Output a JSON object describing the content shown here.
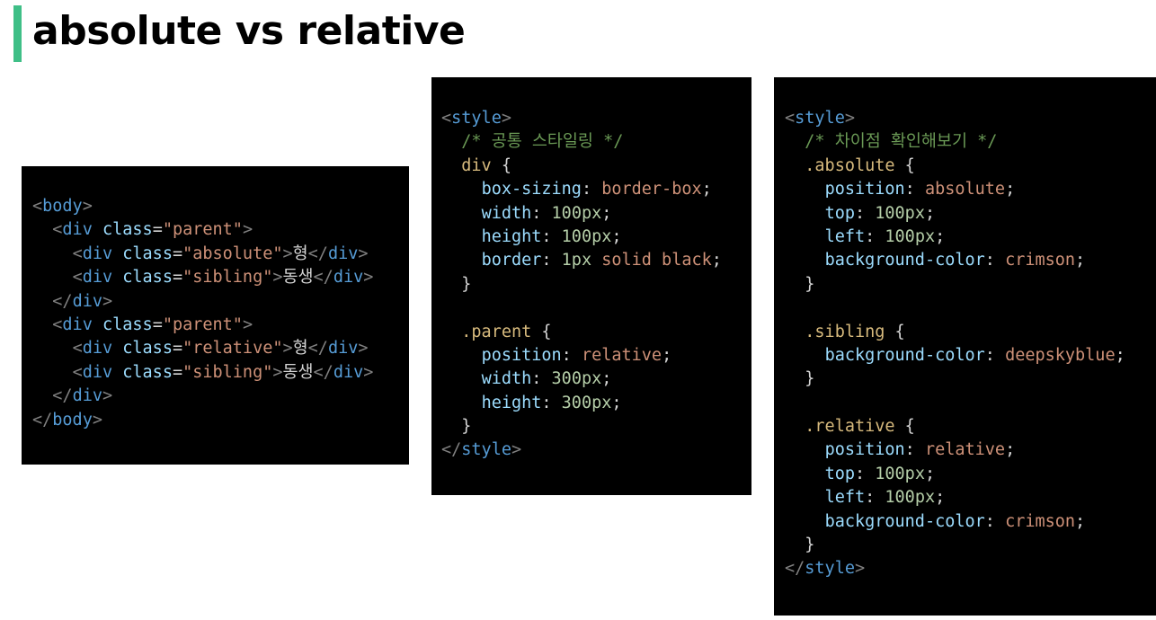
{
  "title": "absolute vs relative",
  "colors": {
    "accent_bar": "#3fbf87",
    "code_background": "#000000",
    "tag": "#569cd6",
    "attribute": "#9cdcfe",
    "string": "#ce9178",
    "comment": "#6a9955",
    "selector": "#d7ba7d",
    "number": "#b5cea8"
  },
  "code_blocks": [
    {
      "name": "html-code",
      "lines": [
        [
          [
            "t-punct",
            "<"
          ],
          [
            "t-tag",
            "body"
          ],
          [
            "t-punct",
            ">"
          ]
        ],
        [
          [
            "t-text",
            "  "
          ],
          [
            "t-punct",
            "<"
          ],
          [
            "t-tag",
            "div"
          ],
          [
            "t-text",
            " "
          ],
          [
            "t-attr",
            "class"
          ],
          [
            "t-eq",
            "="
          ],
          [
            "t-str",
            "\"parent\""
          ],
          [
            "t-punct",
            ">"
          ]
        ],
        [
          [
            "t-text",
            "    "
          ],
          [
            "t-punct",
            "<"
          ],
          [
            "t-tag",
            "div"
          ],
          [
            "t-text",
            " "
          ],
          [
            "t-attr",
            "class"
          ],
          [
            "t-eq",
            "="
          ],
          [
            "t-str",
            "\"absolute\""
          ],
          [
            "t-punct",
            ">"
          ],
          [
            "t-text",
            "형"
          ],
          [
            "t-punct",
            "</"
          ],
          [
            "t-tag",
            "div"
          ],
          [
            "t-punct",
            ">"
          ]
        ],
        [
          [
            "t-text",
            "    "
          ],
          [
            "t-punct",
            "<"
          ],
          [
            "t-tag",
            "div"
          ],
          [
            "t-text",
            " "
          ],
          [
            "t-attr",
            "class"
          ],
          [
            "t-eq",
            "="
          ],
          [
            "t-str",
            "\"sibling\""
          ],
          [
            "t-punct",
            ">"
          ],
          [
            "t-text",
            "동생"
          ],
          [
            "t-punct",
            "</"
          ],
          [
            "t-tag",
            "div"
          ],
          [
            "t-punct",
            ">"
          ]
        ],
        [
          [
            "t-text",
            "  "
          ],
          [
            "t-punct",
            "</"
          ],
          [
            "t-tag",
            "div"
          ],
          [
            "t-punct",
            ">"
          ]
        ],
        [
          [
            "t-text",
            "  "
          ],
          [
            "t-punct",
            "<"
          ],
          [
            "t-tag",
            "div"
          ],
          [
            "t-text",
            " "
          ],
          [
            "t-attr",
            "class"
          ],
          [
            "t-eq",
            "="
          ],
          [
            "t-str",
            "\"parent\""
          ],
          [
            "t-punct",
            ">"
          ]
        ],
        [
          [
            "t-text",
            "    "
          ],
          [
            "t-punct",
            "<"
          ],
          [
            "t-tag",
            "div"
          ],
          [
            "t-text",
            " "
          ],
          [
            "t-attr",
            "class"
          ],
          [
            "t-eq",
            "="
          ],
          [
            "t-str",
            "\"relative\""
          ],
          [
            "t-punct",
            ">"
          ],
          [
            "t-text",
            "형"
          ],
          [
            "t-punct",
            "</"
          ],
          [
            "t-tag",
            "div"
          ],
          [
            "t-punct",
            ">"
          ]
        ],
        [
          [
            "t-text",
            "    "
          ],
          [
            "t-punct",
            "<"
          ],
          [
            "t-tag",
            "div"
          ],
          [
            "t-text",
            " "
          ],
          [
            "t-attr",
            "class"
          ],
          [
            "t-eq",
            "="
          ],
          [
            "t-str",
            "\"sibling\""
          ],
          [
            "t-punct",
            ">"
          ],
          [
            "t-text",
            "동생"
          ],
          [
            "t-punct",
            "</"
          ],
          [
            "t-tag",
            "div"
          ],
          [
            "t-punct",
            ">"
          ]
        ],
        [
          [
            "t-text",
            "  "
          ],
          [
            "t-punct",
            "</"
          ],
          [
            "t-tag",
            "div"
          ],
          [
            "t-punct",
            ">"
          ]
        ],
        [
          [
            "t-punct",
            "</"
          ],
          [
            "t-tag",
            "body"
          ],
          [
            "t-punct",
            ">"
          ]
        ]
      ]
    },
    {
      "name": "style-common-code",
      "lines": [
        [
          [
            "t-punct",
            "<"
          ],
          [
            "t-tag",
            "style"
          ],
          [
            "t-punct",
            ">"
          ]
        ],
        [
          [
            "t-text",
            "  "
          ],
          [
            "t-comment",
            "/* 공통 스타일링 */"
          ]
        ],
        [
          [
            "t-text",
            "  "
          ],
          [
            "t-sel",
            "div"
          ],
          [
            "t-brace",
            " {"
          ]
        ],
        [
          [
            "t-text",
            "    "
          ],
          [
            "t-prop",
            "box-sizing"
          ],
          [
            "t-brace",
            ": "
          ],
          [
            "t-val",
            "border-box"
          ],
          [
            "t-brace",
            ";"
          ]
        ],
        [
          [
            "t-text",
            "    "
          ],
          [
            "t-prop",
            "width"
          ],
          [
            "t-brace",
            ": "
          ],
          [
            "t-num",
            "100px"
          ],
          [
            "t-brace",
            ";"
          ]
        ],
        [
          [
            "t-text",
            "    "
          ],
          [
            "t-prop",
            "height"
          ],
          [
            "t-brace",
            ": "
          ],
          [
            "t-num",
            "100px"
          ],
          [
            "t-brace",
            ";"
          ]
        ],
        [
          [
            "t-text",
            "    "
          ],
          [
            "t-prop",
            "border"
          ],
          [
            "t-brace",
            ": "
          ],
          [
            "t-num",
            "1px"
          ],
          [
            "t-brace",
            " "
          ],
          [
            "t-val",
            "solid black"
          ],
          [
            "t-brace",
            ";"
          ]
        ],
        [
          [
            "t-text",
            "  "
          ],
          [
            "t-brace",
            "}"
          ]
        ],
        [
          [
            "t-text",
            ""
          ]
        ],
        [
          [
            "t-text",
            "  "
          ],
          [
            "t-sel",
            ".parent"
          ],
          [
            "t-brace",
            " {"
          ]
        ],
        [
          [
            "t-text",
            "    "
          ],
          [
            "t-prop",
            "position"
          ],
          [
            "t-brace",
            ": "
          ],
          [
            "t-val",
            "relative"
          ],
          [
            "t-brace",
            ";"
          ]
        ],
        [
          [
            "t-text",
            "    "
          ],
          [
            "t-prop",
            "width"
          ],
          [
            "t-brace",
            ": "
          ],
          [
            "t-num",
            "300px"
          ],
          [
            "t-brace",
            ";"
          ]
        ],
        [
          [
            "t-text",
            "    "
          ],
          [
            "t-prop",
            "height"
          ],
          [
            "t-brace",
            ": "
          ],
          [
            "t-num",
            "300px"
          ],
          [
            "t-brace",
            ";"
          ]
        ],
        [
          [
            "t-text",
            "  "
          ],
          [
            "t-brace",
            "}"
          ]
        ],
        [
          [
            "t-punct",
            "</"
          ],
          [
            "t-tag",
            "style"
          ],
          [
            "t-punct",
            ">"
          ]
        ]
      ]
    },
    {
      "name": "style-diff-code",
      "lines": [
        [
          [
            "t-punct",
            "<"
          ],
          [
            "t-tag",
            "style"
          ],
          [
            "t-punct",
            ">"
          ]
        ],
        [
          [
            "t-text",
            "  "
          ],
          [
            "t-comment",
            "/* 차이점 확인해보기 */"
          ]
        ],
        [
          [
            "t-text",
            "  "
          ],
          [
            "t-sel",
            ".absolute"
          ],
          [
            "t-brace",
            " {"
          ]
        ],
        [
          [
            "t-text",
            "    "
          ],
          [
            "t-prop",
            "position"
          ],
          [
            "t-brace",
            ": "
          ],
          [
            "t-val",
            "absolute"
          ],
          [
            "t-brace",
            ";"
          ]
        ],
        [
          [
            "t-text",
            "    "
          ],
          [
            "t-prop",
            "top"
          ],
          [
            "t-brace",
            ": "
          ],
          [
            "t-num",
            "100px"
          ],
          [
            "t-brace",
            ";"
          ]
        ],
        [
          [
            "t-text",
            "    "
          ],
          [
            "t-prop",
            "left"
          ],
          [
            "t-brace",
            ": "
          ],
          [
            "t-num",
            "100px"
          ],
          [
            "t-brace",
            ";"
          ]
        ],
        [
          [
            "t-text",
            "    "
          ],
          [
            "t-prop",
            "background-color"
          ],
          [
            "t-brace",
            ": "
          ],
          [
            "t-val",
            "crimson"
          ],
          [
            "t-brace",
            ";"
          ]
        ],
        [
          [
            "t-text",
            "  "
          ],
          [
            "t-brace",
            "}"
          ]
        ],
        [
          [
            "t-text",
            ""
          ]
        ],
        [
          [
            "t-text",
            "  "
          ],
          [
            "t-sel",
            ".sibling"
          ],
          [
            "t-brace",
            " {"
          ]
        ],
        [
          [
            "t-text",
            "    "
          ],
          [
            "t-prop",
            "background-color"
          ],
          [
            "t-brace",
            ": "
          ],
          [
            "t-val",
            "deepskyblue"
          ],
          [
            "t-brace",
            ";"
          ]
        ],
        [
          [
            "t-text",
            "  "
          ],
          [
            "t-brace",
            "}"
          ]
        ],
        [
          [
            "t-text",
            ""
          ]
        ],
        [
          [
            "t-text",
            "  "
          ],
          [
            "t-sel",
            ".relative"
          ],
          [
            "t-brace",
            " {"
          ]
        ],
        [
          [
            "t-text",
            "    "
          ],
          [
            "t-prop",
            "position"
          ],
          [
            "t-brace",
            ": "
          ],
          [
            "t-val",
            "relative"
          ],
          [
            "t-brace",
            ";"
          ]
        ],
        [
          [
            "t-text",
            "    "
          ],
          [
            "t-prop",
            "top"
          ],
          [
            "t-brace",
            ": "
          ],
          [
            "t-num",
            "100px"
          ],
          [
            "t-brace",
            ";"
          ]
        ],
        [
          [
            "t-text",
            "    "
          ],
          [
            "t-prop",
            "left"
          ],
          [
            "t-brace",
            ": "
          ],
          [
            "t-num",
            "100px"
          ],
          [
            "t-brace",
            ";"
          ]
        ],
        [
          [
            "t-text",
            "    "
          ],
          [
            "t-prop",
            "background-color"
          ],
          [
            "t-brace",
            ": "
          ],
          [
            "t-val",
            "crimson"
          ],
          [
            "t-brace",
            ";"
          ]
        ],
        [
          [
            "t-text",
            "  "
          ],
          [
            "t-brace",
            "}"
          ]
        ],
        [
          [
            "t-punct",
            "</"
          ],
          [
            "t-tag",
            "style"
          ],
          [
            "t-punct",
            ">"
          ]
        ]
      ]
    }
  ]
}
